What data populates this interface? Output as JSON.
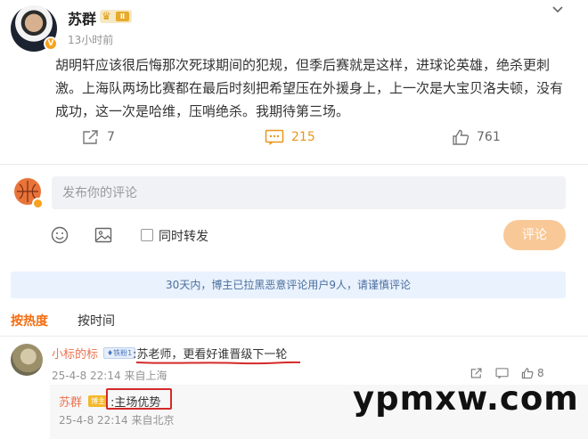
{
  "post": {
    "author": "苏群",
    "vip_level": "Ⅱ",
    "timestamp": "13小时前",
    "text": "胡明轩应该很后悔那次死球期间的犯规，但季后赛就是这样，进球论英雄，绝杀更刺激。上海队两场比赛都在最后时刻把希望压在外援身上，上一次是大宝贝洛夫顿，没有成功，这一次是哈维，压哨绝杀。我期待第三场。",
    "shares": "7",
    "comments": "215",
    "likes": "761"
  },
  "composer": {
    "placeholder": "发布你的评论",
    "repost_label": "同时转发",
    "submit_label": "评论"
  },
  "notice": "30天内，博主已拉黑恶意评论用户9人，请谨慎评论",
  "tabs": {
    "hot": "按热度",
    "time": "按时间"
  },
  "comments": [
    {
      "user": "小标的标",
      "badge": "铁粉1",
      "text": ":苏老师，更看好谁晋级下一轮",
      "date": "25-4-8 22:14",
      "location": "来自上海",
      "likes": "8",
      "reply": {
        "user": "苏群",
        "badge": "博主",
        "text": ":主场优势",
        "date": "25-4-8 22:14",
        "location": "来自北京"
      }
    }
  ],
  "watermark": "ypmxw.com",
  "colors": {
    "accent": "#f56c0f",
    "comment_count": "#e8961b",
    "username": "#eb7350",
    "notice_bg": "#e9f2fd",
    "annotation_red": "#d42a2a"
  }
}
